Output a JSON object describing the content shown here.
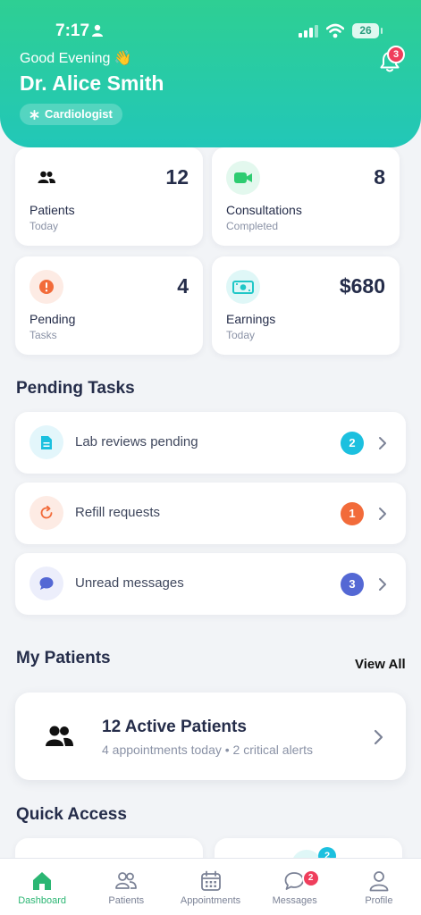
{
  "status_bar": {
    "time": "7:17",
    "battery": "26"
  },
  "header": {
    "greeting": "Good Evening 👋",
    "doctor_name": "Dr. Alice Smith",
    "specialty": "Cardiologist",
    "notification_count": "3"
  },
  "stats": [
    {
      "value": "12",
      "label": "Patients",
      "sub": "Today",
      "icon": "patients-icon",
      "color": "#111111",
      "bg": "#ffffff"
    },
    {
      "value": "8",
      "label": "Consultations",
      "sub": "Completed",
      "icon": "video-icon",
      "color": "#2ecc71",
      "bg": "#e3f8ee"
    },
    {
      "value": "4",
      "label": "Pending",
      "sub": "Tasks",
      "icon": "alert-icon",
      "color": "#f26b3a",
      "bg": "#fdebe4"
    },
    {
      "value": "$680",
      "label": "Earnings",
      "sub": "Today",
      "icon": "money-icon",
      "color": "#1fc7c7",
      "bg": "#dff7f7"
    }
  ],
  "pending_tasks": {
    "title": "Pending Tasks",
    "items": [
      {
        "label": "Lab reviews pending",
        "count": "2",
        "badge_color": "#1cc0df",
        "icon": "document-icon",
        "icon_color": "#1cc0df",
        "icon_bg": "#e3f6fb"
      },
      {
        "label": "Refill requests",
        "count": "1",
        "badge_color": "#f26b3a",
        "icon": "refresh-icon",
        "icon_color": "#f26b3a",
        "icon_bg": "#fdebe4"
      },
      {
        "label": "Unread messages",
        "count": "3",
        "badge_color": "#5468d4",
        "icon": "chat-icon",
        "icon_color": "#5468d4",
        "icon_bg": "#eceefb"
      }
    ]
  },
  "my_patients": {
    "title": "My Patients",
    "view_all": "View All",
    "card_title": "12 Active Patients",
    "card_sub": "4 appointments today • 2 critical alerts"
  },
  "quick_access": {
    "title": "Quick Access",
    "partial_badge": "2"
  },
  "bottom_nav": {
    "items": [
      {
        "label": "Dashboard",
        "icon": "home-icon",
        "active": true
      },
      {
        "label": "Patients",
        "icon": "patients-icon",
        "active": false
      },
      {
        "label": "Appointments",
        "icon": "calendar-icon",
        "active": false
      },
      {
        "label": "Messages",
        "icon": "messages-icon",
        "active": false,
        "badge": "2"
      },
      {
        "label": "Profile",
        "icon": "profile-icon",
        "active": false
      }
    ]
  },
  "colors": {
    "accent": "#2ecf93",
    "accent_end": "#22c7b8",
    "alert": "#ef3e5c"
  }
}
